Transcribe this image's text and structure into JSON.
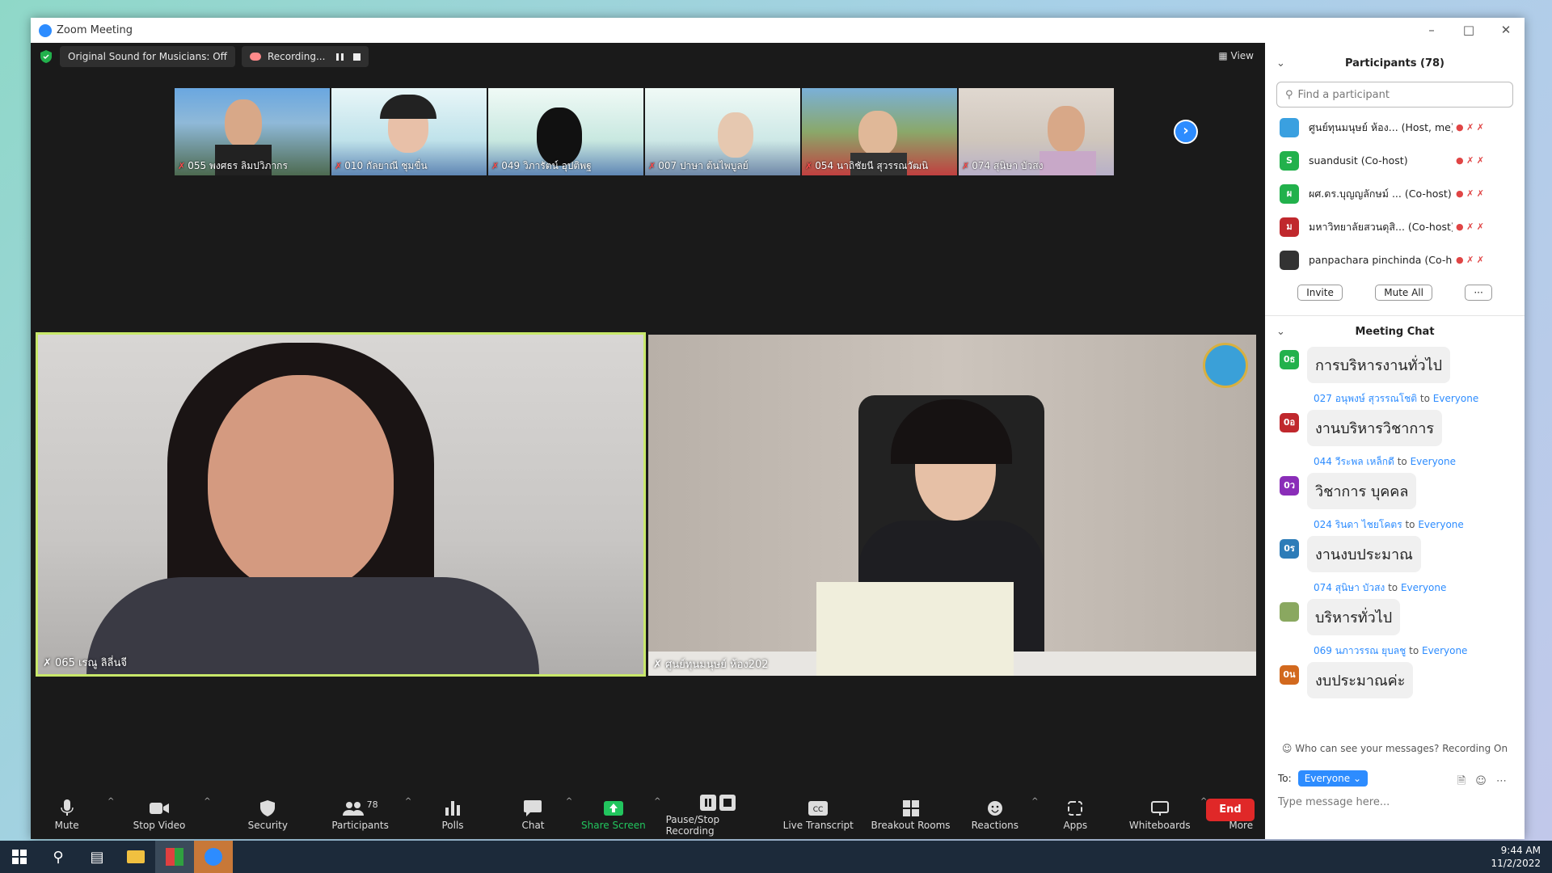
{
  "window": {
    "title": "Zoom Meeting"
  },
  "topbar": {
    "sound_label": "Original Sound for Musicians: Off",
    "recording_label": "Recording...",
    "view_label": "View"
  },
  "thumbnails": [
    {
      "name": "055 พงศธร ลิมปวิภากร"
    },
    {
      "name": "010 กัลยาณี ชุมขื่น"
    },
    {
      "name": "049 วิภารัตน์ อุปติพฐ"
    },
    {
      "name": "007 ปาษา ต้นไพบูลย์"
    },
    {
      "name": "054 นาถิชัยนี สุวรรณวัฒนิ"
    },
    {
      "name": "074 สุนิษา บัวสง"
    }
  ],
  "main_tiles": {
    "left_name": "065 เรณู ลิลี่นจี",
    "right_name": "ศูนย์ทุนมนุษย์ ห้อง202"
  },
  "toolbar": {
    "mute": "Mute",
    "stop_video": "Stop Video",
    "security": "Security",
    "participants": "Participants",
    "participants_count": "78",
    "polls": "Polls",
    "chat": "Chat",
    "share_screen": "Share Screen",
    "pause_stop": "Pause/Stop Recording",
    "live_transcript": "Live Transcript",
    "breakout": "Breakout Rooms",
    "reactions": "Reactions",
    "apps": "Apps",
    "whiteboards": "Whiteboards",
    "more": "More",
    "end": "End"
  },
  "participants_panel": {
    "title": "Participants (78)",
    "search_placeholder": "Find a participant",
    "items": [
      {
        "name": "ศูนย์ทุนมนุษย์ ห้อง... (Host, me)",
        "initial": "",
        "color": "#3aa0e0"
      },
      {
        "name": "suandusit (Co-host)",
        "initial": "S",
        "color": "#22b14c"
      },
      {
        "name": "ผศ.ดร.บุญญลักษม์ ... (Co-host)",
        "initial": "ผ",
        "color": "#22b14c"
      },
      {
        "name": "มหาวิทยาลัยสวนดุสิ... (Co-host)",
        "initial": "ม",
        "color": "#c0282d"
      },
      {
        "name": "panpachara pinchinda (Co-host)",
        "initial": "",
        "color": "#333333"
      }
    ],
    "invite": "Invite",
    "mute_all": "Mute All",
    "more": "···"
  },
  "chat_panel": {
    "title": "Meeting Chat",
    "messages": [
      {
        "sender": "",
        "initial": "0ธ",
        "color": "#22b14c",
        "text": "การบริหารงานทั่วไป"
      },
      {
        "sender": "027 อนุพงษ์ สุวรรณโชติ",
        "initial": "0อ",
        "color": "#c0282d",
        "text": "งานบริหารวิชาการ"
      },
      {
        "sender": "044 วีระพล เหล็กดี",
        "initial": "0ว",
        "color": "#8a2db8",
        "text": "วิชาการ บุคคล"
      },
      {
        "sender": "024 รินดา ไชยโคตร",
        "initial": "0ร",
        "color": "#2d7cb8",
        "text": "งานงบประมาณ"
      },
      {
        "sender": "074 สุนิษา บัวสง",
        "initial": "",
        "color": "#8aa860",
        "text": "บริหารทั่วไป"
      },
      {
        "sender": "069 นภาวรรณ ยุบลชู",
        "initial": "0น",
        "color": "#d2691e",
        "text": "งบประมาณค่ะ"
      }
    ],
    "to_word": "to",
    "everyone": "Everyone",
    "who_can_see": "Who can see your messages? Recording On",
    "to_label": "To:",
    "recipient": "Everyone",
    "type_placeholder": "Type message here..."
  },
  "taskbar": {
    "time": "9:44 AM",
    "date": "11/2/2022"
  }
}
